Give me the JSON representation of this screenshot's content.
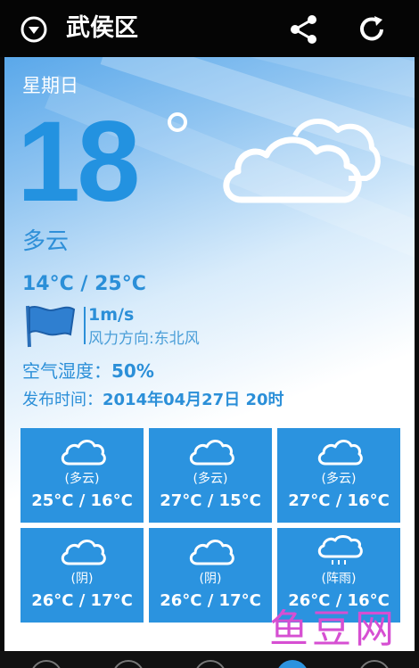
{
  "header": {
    "city": "武侯区",
    "icons": {
      "location": "dropdown-circle-icon",
      "share": "share-icon",
      "refresh": "refresh-icon"
    }
  },
  "current": {
    "weekday": "星期日",
    "temperature": "18",
    "condition": "多云",
    "range": "14°C / 25°C",
    "wind_speed": "1m/s",
    "wind_direction": "风力方向:东北风",
    "humidity_label": "空气湿度：",
    "humidity_value": "50%",
    "publish_label": "发布时间：",
    "publish_value": "2014年04月27日  20时"
  },
  "forecast": [
    {
      "icon": "cloud-icon",
      "condition": "(多云)",
      "range": "25°C /  16°C"
    },
    {
      "icon": "cloud-icon",
      "condition": "(多云)",
      "range": "27°C /  15°C"
    },
    {
      "icon": "cloud-icon",
      "condition": "(多云)",
      "range": "27°C /  16°C"
    },
    {
      "icon": "cloud-icon",
      "condition": "(阴)",
      "range": "26°C /  17°C"
    },
    {
      "icon": "cloud-icon",
      "condition": "(阴)",
      "range": "26°C /  17°C"
    },
    {
      "icon": "rain-cloud-icon",
      "condition": "(阵雨)",
      "range": "26°C /  16°C"
    }
  ],
  "watermark": "鱼豆网",
  "colors": {
    "accent": "#2b93df",
    "topbar": "#050505",
    "watermark": "#d64fd2"
  }
}
